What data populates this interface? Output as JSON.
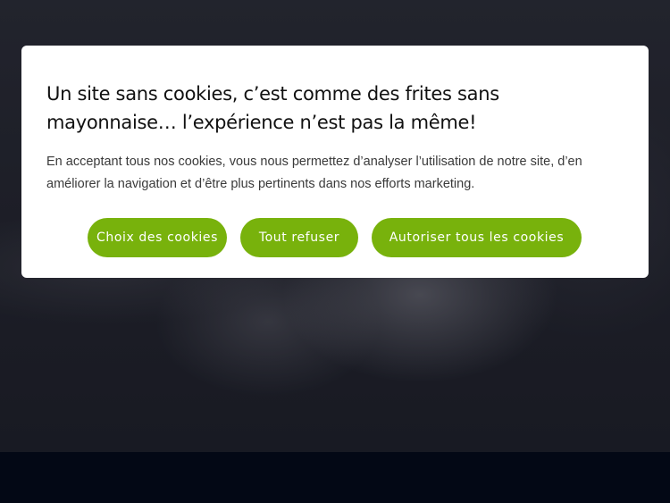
{
  "cookie_banner": {
    "title": "Un site sans cookies, c’est comme des frites sans mayonnaise… l’expérience n’est pas la même!",
    "description": "En acceptant tous nos cookies, vous nous permettez d’analyser l’utilisation de notre site, d’en améliorer la navigation et d’être plus pertinents dans nos efforts marketing.",
    "buttons": {
      "choice": "Choix des cookies",
      "refuse": "Tout refuser",
      "accept": "Autoriser tous les cookies"
    },
    "accent_color": "#78b20c"
  },
  "page": {
    "footer_color": "#030815"
  }
}
